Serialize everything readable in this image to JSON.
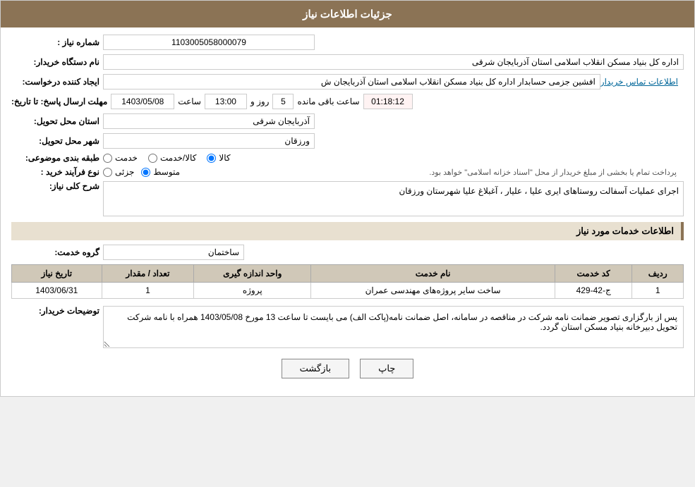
{
  "header": {
    "title": "جزئیات اطلاعات نیاز"
  },
  "fields": {
    "need_number_label": "شماره نیاز :",
    "need_number_value": "1103005058000079",
    "buyer_org_label": "نام دستگاه خریدار:",
    "buyer_org_value": "اداره کل بنیاد مسکن انقلاب اسلامی استان آذربایجان شرقی",
    "creator_label": "ایجاد کننده درخواست:",
    "creator_value": "افشین جزمی حسابدار اداره کل بنیاد مسکن انقلاب اسلامی استان آذربایجان ش",
    "contact_link": "اطلاعات تماس خریدار",
    "reply_deadline_label": "مهلت ارسال پاسخ: تا تاریخ:",
    "reply_date": "1403/05/08",
    "reply_time_label": "ساعت",
    "reply_time": "13:00",
    "reply_day_label": "روز و",
    "reply_days": "5",
    "reply_remaining_label": "ساعت باقی مانده",
    "reply_remaining": "01:18:12",
    "delivery_province_label": "استان محل تحویل:",
    "delivery_province": "آذربایجان شرقی",
    "delivery_city_label": "شهر محل تحویل:",
    "delivery_city": "ورزقان",
    "classification_label": "طبقه بندی موضوعی:",
    "classification_options": [
      "خدمت",
      "کالا/خدمت",
      "کالا"
    ],
    "classification_selected": "کالا",
    "process_label": "نوع فرآیند خرید :",
    "process_options": [
      "جزئی",
      "متوسط"
    ],
    "process_desc": "پرداخت تمام یا بخشی از مبلغ خریدار از محل \"اسناد خزانه اسلامی\" خواهد بود.",
    "need_desc_label": "شرح کلی نیاز:",
    "need_desc_value": "اجرای عملیات آسفالت روستاهای ایری علیا ، علیار ، آغبلاغ علیا شهرستان ورزقان",
    "services_section_title": "اطلاعات خدمات مورد نیاز",
    "service_group_label": "گروه خدمت:",
    "service_group_value": "ساختمان",
    "table": {
      "headers": [
        "ردیف",
        "کد خدمت",
        "نام خدمت",
        "واحد اندازه گیری",
        "تعداد / مقدار",
        "تاریخ نیاز"
      ],
      "rows": [
        {
          "row": "1",
          "code": "ج-42-429",
          "name": "ساخت سایر پروژه‌های مهندسی عمران",
          "unit": "پروژه",
          "quantity": "1",
          "date": "1403/06/31"
        }
      ]
    },
    "buyer_desc_label": "توضیحات خریدار:",
    "buyer_desc_value": "پس از بارگزاری تصویر ضمانت نامه شرکت در مناقصه در سامانه، اصل ضمانت نامه(پاکت الف) می بایست تا ساعت 13 مورخ 1403/05/08 همراه با نامه شرکت تحویل دبیرخانه بنیاد مسکن استان گردد."
  },
  "buttons": {
    "back_label": "بازگشت",
    "print_label": "چاپ"
  }
}
